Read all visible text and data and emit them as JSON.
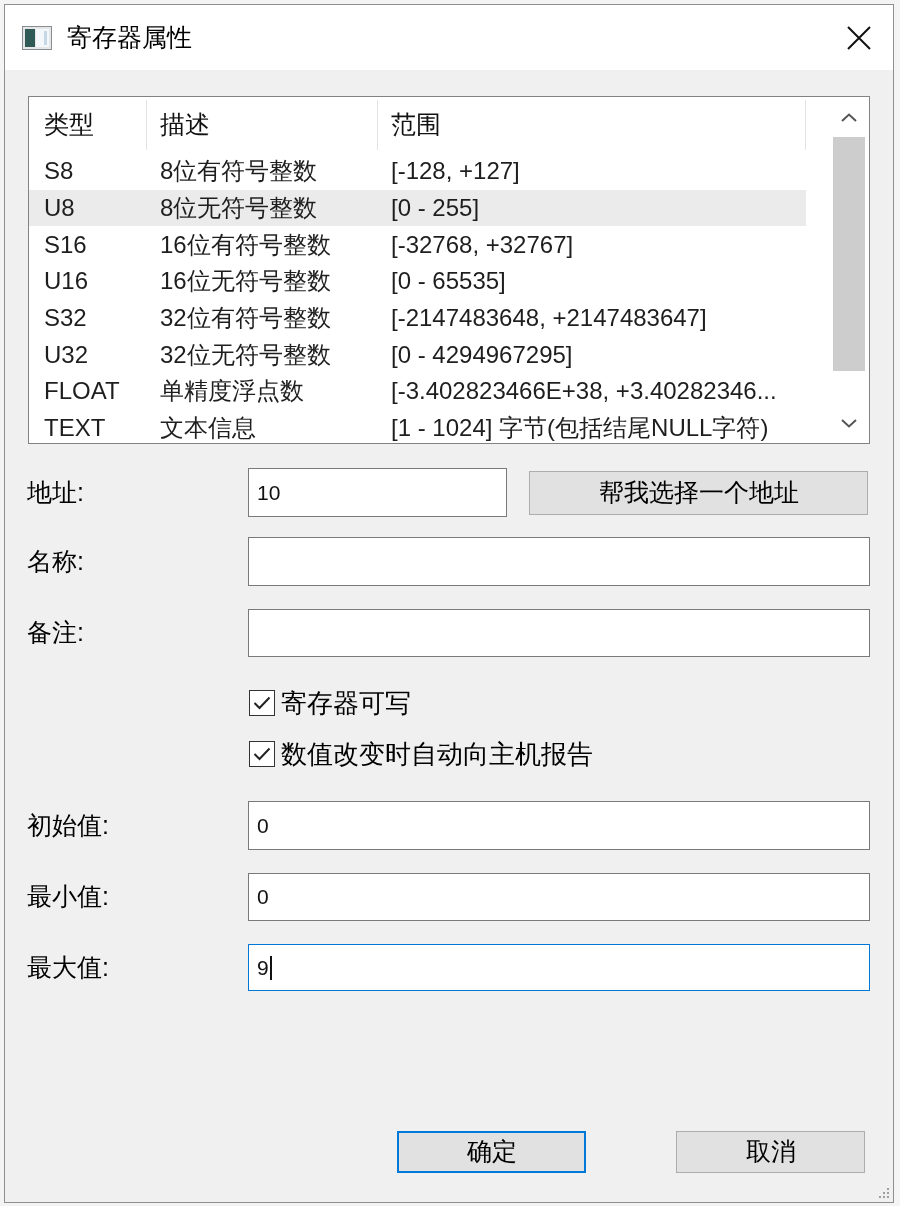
{
  "window": {
    "title": "寄存器属性"
  },
  "type_table": {
    "columns": [
      "类型",
      "描述",
      "范围"
    ],
    "rows": [
      {
        "cells": [
          "S8",
          "8位有符号整数",
          "[-128, +127]"
        ],
        "selected": false
      },
      {
        "cells": [
          "U8",
          "8位无符号整数",
          "[0 - 255]"
        ],
        "selected": true
      },
      {
        "cells": [
          "S16",
          "16位有符号整数",
          "[-32768, +32767]"
        ],
        "selected": false
      },
      {
        "cells": [
          "U16",
          "16位无符号整数",
          "[0 - 65535]"
        ],
        "selected": false
      },
      {
        "cells": [
          "S32",
          "32位有符号整数",
          "[-2147483648, +2147483647]"
        ],
        "selected": false
      },
      {
        "cells": [
          "U32",
          "32位无符号整数",
          "[0 - 4294967295]"
        ],
        "selected": false
      },
      {
        "cells": [
          "FLOAT",
          "单精度浮点数",
          "[-3.402823466E+38, +3.40282346..."
        ],
        "selected": false
      },
      {
        "cells": [
          "TEXT",
          "文本信息",
          "[1 - 1024] 字节(包括结尾NULL字符)"
        ],
        "selected": false
      }
    ]
  },
  "address": {
    "label": "地址:",
    "value": "10",
    "focused": false,
    "button": "帮我选择一个地址"
  },
  "text_fields": [
    {
      "label": "名称:",
      "focused": false
    },
    {
      "label": "备注:",
      "focused": false
    }
  ],
  "checkboxes": [
    {
      "label": "寄存器可写",
      "checked": true
    },
    {
      "label": "数值改变时自动向主机报告",
      "checked": true
    }
  ],
  "value_fields": [
    {
      "label": "初始值:",
      "value": "0",
      "focused": false
    },
    {
      "label": "最小值:",
      "value": "0",
      "focused": false
    },
    {
      "label": "最大值:",
      "value": "9",
      "focused": true
    }
  ],
  "buttons": [
    {
      "label": "确定",
      "default": true
    },
    {
      "label": "取消",
      "default": false
    }
  ]
}
